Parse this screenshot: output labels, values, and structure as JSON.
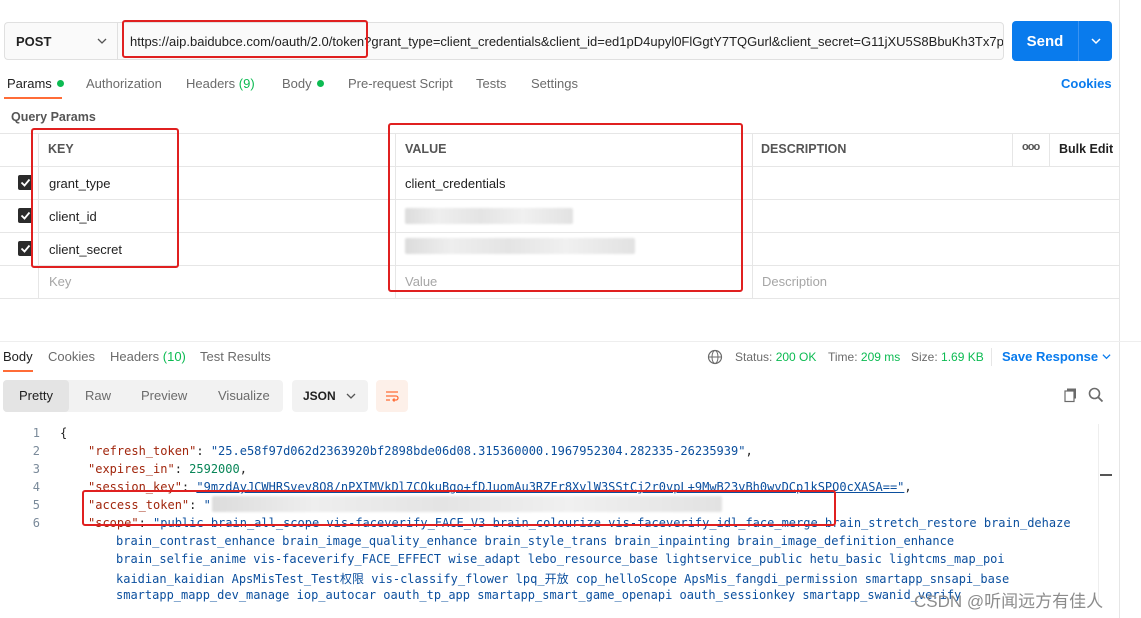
{
  "request": {
    "method": "POST",
    "url": "https://aip.baidubce.com/oauth/2.0/token?grant_type=client_credentials&client_id=ed1pD4upyl0FlGgtY7TQGurl&client_secret=G11jXU5S8BbuKh3Tx7p...",
    "send_label": "Send"
  },
  "tabs": [
    {
      "label": "Params",
      "count": ""
    },
    {
      "label": "Authorization",
      "count": ""
    },
    {
      "label": "Headers",
      "count": "(9)"
    },
    {
      "label": "Body",
      "count": ""
    },
    {
      "label": "Pre-request Script",
      "count": ""
    },
    {
      "label": "Tests",
      "count": ""
    },
    {
      "label": "Settings",
      "count": ""
    }
  ],
  "cookies_label": "Cookies",
  "params": {
    "title": "Query Params",
    "headers": {
      "key": "KEY",
      "value": "VALUE",
      "description": "DESCRIPTION",
      "more": "ooo",
      "bulk": "Bulk Edit"
    },
    "rows": [
      {
        "key": "grant_type",
        "value": "client_credentials"
      },
      {
        "key": "client_id",
        "value": ""
      },
      {
        "key": "client_secret",
        "value": ""
      }
    ],
    "placeholder": {
      "key": "Key",
      "value": "Value",
      "description": "Description"
    }
  },
  "response": {
    "tabs": [
      {
        "label": "Body",
        "count": ""
      },
      {
        "label": "Cookies",
        "count": ""
      },
      {
        "label": "Headers",
        "count": "(10)"
      },
      {
        "label": "Test Results",
        "count": ""
      }
    ],
    "status_label": "Status:",
    "status_value": "200 OK",
    "time_label": "Time:",
    "time_value": "209 ms",
    "size_label": "Size:",
    "size_value": "1.69 KB",
    "save_label": "Save Response",
    "views": [
      "Pretty",
      "Raw",
      "Preview",
      "Visualize"
    ],
    "format": "JSON",
    "code": {
      "line_numbers": [
        "1",
        "2",
        "3",
        "4",
        "5",
        "6"
      ],
      "open_brace": "{",
      "refresh_token_key": "\"refresh_token\"",
      "refresh_token_value": "\"25.e58f97d062d2363920bf2898bde06d08.315360000.1967952304.282335-26235939\"",
      "expires_in_key": "\"expires_in\"",
      "expires_in_value": "2592000",
      "session_key_key": "\"session_key\"",
      "session_key_value": "\"9mzdAyJCWHRSvev8O8/nPXIMVkDl7COkuBgo+fDJuomAu3RZFr8XvlW3SStCj2r0vpL+9MwB23vBh0wvDCp1kSPO0cXASA==\"",
      "access_token_key": "\"access_token\"",
      "access_token_value": "\"",
      "scope_key": "\"scope\"",
      "scope_lines": [
        "\"public brain_all_scope vis-faceverify_FACE_V3 brain_colourize vis-faceverify_idl_face_merge brain_stretch_restore brain_dehaze",
        "brain_contrast_enhance brain_image_quality_enhance brain_style_trans brain_inpainting brain_image_definition_enhance",
        "brain_selfie_anime vis-faceverify_FACE_EFFECT wise_adapt lebo_resource_base lightservice_public hetu_basic lightcms_map_poi",
        "kaidian_kaidian ApsMisTest_Test权限 vis-classify_flower lpq_开放 cop_helloScope ApsMis_fangdi_permission smartapp_snsapi_base",
        "smartapp_mapp_dev_manage iop_autocar oauth_tp_app smartapp_smart_game_openapi oauth_sessionkey smartapp_swanid_verify"
      ]
    }
  },
  "watermark": "CSDN @听闻远方有佳人",
  "colors": {
    "accent": "#097bed",
    "active_tab": "#ff6c37",
    "ok": "#0cbb52",
    "highlight": "#e02020"
  }
}
